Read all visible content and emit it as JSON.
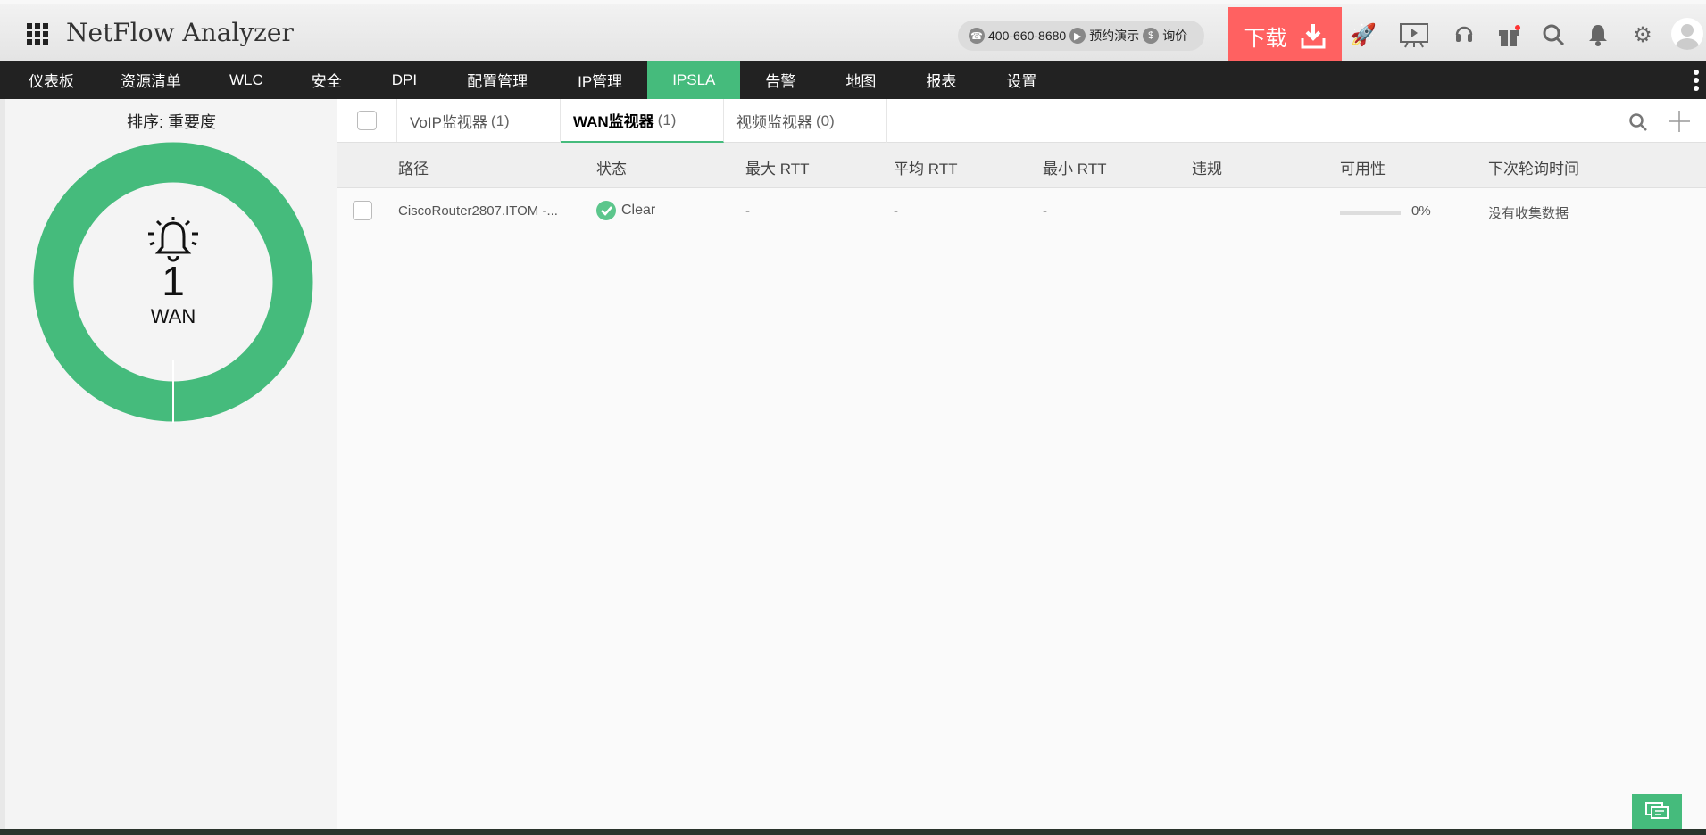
{
  "header": {
    "title": "NetFlow Analyzer",
    "phone": "400-660-8680",
    "demo": "预约演示",
    "price": "询价",
    "download": "下载"
  },
  "nav": [
    "仪表板",
    "资源清单",
    "WLC",
    "安全",
    "DPI",
    "配置管理",
    "IP管理",
    "IPSLA",
    "告警",
    "地图",
    "报表",
    "设置"
  ],
  "sidebar": {
    "sort": "排序:  重要度",
    "count": "1",
    "type": "WAN"
  },
  "tabs": [
    {
      "label": "VoIP监视器",
      "count": "(1)"
    },
    {
      "label": "WAN监视器",
      "count": "(1)"
    },
    {
      "label": "视频监视器",
      "count": "(0)"
    }
  ],
  "columns": [
    "路径",
    "状态",
    "最大 RTT",
    "平均 RTT",
    "最小 RTT",
    "违规",
    "可用性",
    "下次轮询时间"
  ],
  "row": {
    "path": "CiscoRouter2807.ITOM -...",
    "status": "Clear",
    "max": "-",
    "avg": "-",
    "min": "-",
    "violation": "",
    "availability": "0%",
    "availability_value": 0,
    "next_poll": "没有收集数据"
  },
  "colors": {
    "accent": "#45bb7c",
    "download": "#ff6161"
  }
}
